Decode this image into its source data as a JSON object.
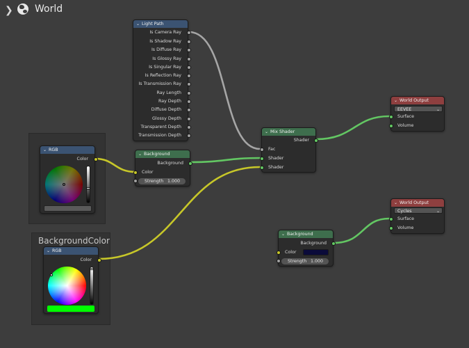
{
  "header": {
    "chevron": "chevron-right-icon",
    "icon": "world-icon",
    "title": "World"
  },
  "frames": {
    "bg_color_label": "BackgroundColor"
  },
  "light_path": {
    "title": "Light Path",
    "outputs": [
      "Is Camera Ray",
      "Is Shadow Ray",
      "Is Diffuse Ray",
      "Is Glossy Ray",
      "Is Singular Ray",
      "Is Reflection Ray",
      "Is Transmission Ray",
      "Ray Length",
      "Ray Depth",
      "Diffuse Depth",
      "Glossy Depth",
      "Transparent Depth",
      "Transmission Depth"
    ]
  },
  "rgb_top": {
    "title": "RGB",
    "output": "Color",
    "color": "#5a5a5a"
  },
  "rgb_bottom": {
    "title": "RGB",
    "output": "Color",
    "color": "#00ff00"
  },
  "bg1": {
    "title": "Background",
    "output": "Background",
    "color_label": "Color",
    "strength_label": "Strength",
    "strength_value": "1.000"
  },
  "mix": {
    "title": "Mix Shader",
    "output": "Shader",
    "fac_label": "Fac",
    "shader1": "Shader",
    "shader2": "Shader"
  },
  "wo_eevee": {
    "title": "World Output",
    "target": "EEVEE",
    "surface": "Surface",
    "volume": "Volume"
  },
  "wo_cycles": {
    "title": "World Output",
    "target": "Cycles",
    "surface": "Surface",
    "volume": "Volume"
  },
  "bg2": {
    "title": "Background",
    "output": "Background",
    "color_label": "Color",
    "color_value": "#0b0b3a",
    "strength_label": "Strength",
    "strength_value": "1.000"
  },
  "colors": {
    "link_grey": "#a6a6a6",
    "link_green": "#63c763",
    "link_yellow": "#c7c729",
    "header_input": "#80321f",
    "header_shader": "#3e6e4d",
    "header_output": "#8e3f3f"
  }
}
